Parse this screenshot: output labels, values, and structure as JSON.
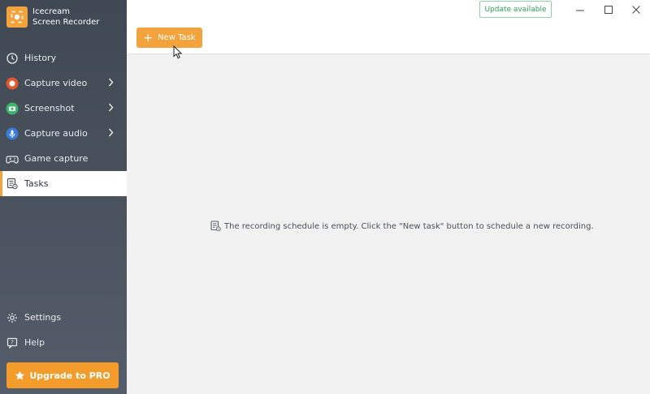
{
  "app": {
    "brand_line1": "Icecream",
    "brand_line2": "Screen Recorder",
    "accent": "#f3a33c"
  },
  "sidebar": {
    "items": [
      {
        "label": "History",
        "icon": "clock-icon"
      },
      {
        "label": "Capture video",
        "icon": "record-icon",
        "has_submenu": true
      },
      {
        "label": "Screenshot",
        "icon": "camera-icon",
        "has_submenu": true
      },
      {
        "label": "Capture audio",
        "icon": "microphone-icon",
        "has_submenu": true
      },
      {
        "label": "Game capture",
        "icon": "gamepad-icon"
      },
      {
        "label": "Tasks",
        "icon": "tasks-icon",
        "active": true
      }
    ],
    "bottom_items": [
      {
        "label": "Settings",
        "icon": "gear-icon"
      },
      {
        "label": "Help",
        "icon": "help-icon"
      }
    ],
    "upgrade_label": "Upgrade to PRO"
  },
  "header": {
    "update_label": "Update available",
    "new_task_label": "New Task"
  },
  "main": {
    "empty_message": "The recording schedule is empty. Click the \"New task\" button to schedule a new recording."
  }
}
